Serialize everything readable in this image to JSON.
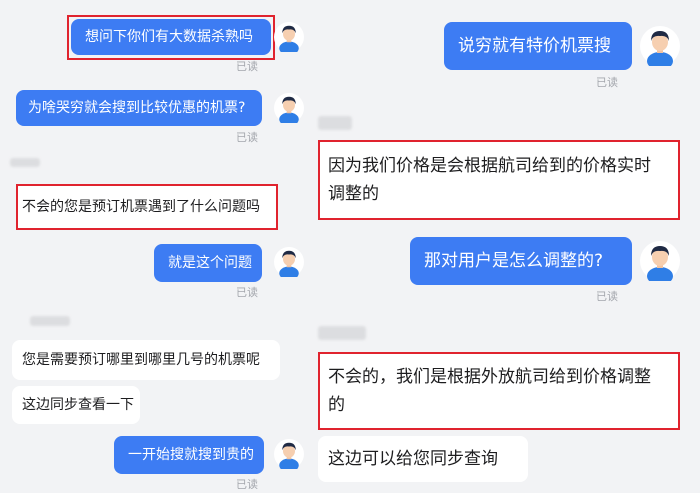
{
  "colors": {
    "outgoing_bubble": "#3d7cf3",
    "incoming_bubble": "#ffffff",
    "highlight_box": "#e0232e",
    "background": "#f2f3f5",
    "read_receipt": "#a4a7ad"
  },
  "left_chat": {
    "messages": [
      {
        "text": "想问下你们有大数据杀熟吗",
        "read": "已读"
      },
      {
        "text": "为啥哭穷就会搜到比较优惠的机票?",
        "read": "已读"
      },
      {
        "text": "不会的您是预订机票遇到了什么问题吗"
      },
      {
        "text": "就是这个问题",
        "read": "已读"
      },
      {
        "text": "您是需要预订哪里到哪里几号的机票呢"
      },
      {
        "text": "这边同步查看一下"
      },
      {
        "text": "一开始搜就搜到贵的",
        "read": "已读"
      }
    ]
  },
  "right_chat": {
    "messages": [
      {
        "text": "说穷就有特价机票搜",
        "read": "已读"
      },
      {
        "line1": "因为我们价格是会根据航司给到的价格实时",
        "line2": "调整的"
      },
      {
        "text": "那对用户是怎么调整的?",
        "read": "已读"
      },
      {
        "line1": "不会的，我们是根据外放航司给到价格调整",
        "line2": "的"
      },
      {
        "text": "这边可以给您同步查询"
      }
    ]
  },
  "avatar_icon": "user-avatar-icon"
}
